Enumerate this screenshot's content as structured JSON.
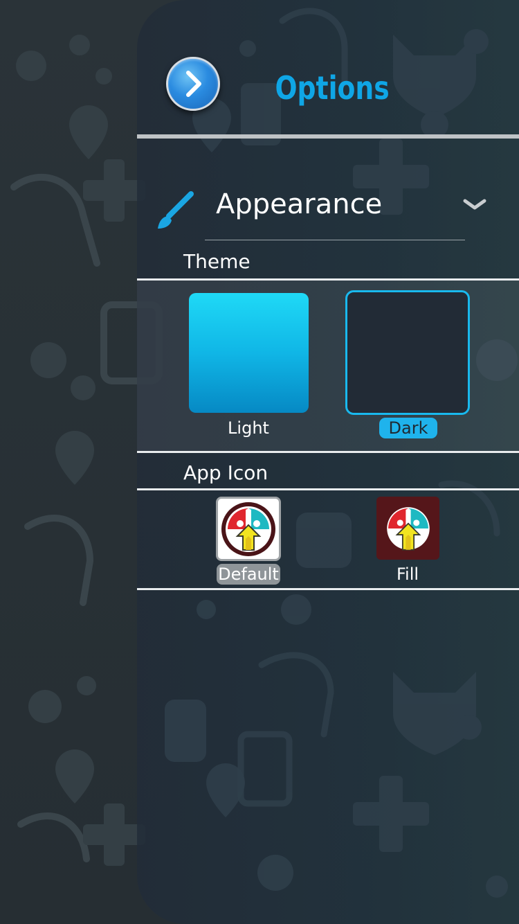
{
  "header": {
    "title": "Options",
    "back_icon": "chevron-right-icon"
  },
  "appearance": {
    "label": "Appearance",
    "icon": "paintbrush-icon",
    "expand_icon": "chevron-down-icon",
    "expanded": true
  },
  "theme": {
    "label": "Theme",
    "selected": "Dark",
    "options": [
      {
        "label": "Light",
        "color": "#10b6e6"
      },
      {
        "label": "Dark",
        "color": "#222b36"
      }
    ]
  },
  "app_icon": {
    "label": "App Icon",
    "selected": "Default",
    "options": [
      {
        "label": "Default",
        "background": "#ffffff"
      },
      {
        "label": "Fill",
        "background": "#55161a"
      }
    ]
  },
  "colors": {
    "accent": "#0fa6e6",
    "selected_badge": "#1fb3ec",
    "background": "#262e33"
  }
}
